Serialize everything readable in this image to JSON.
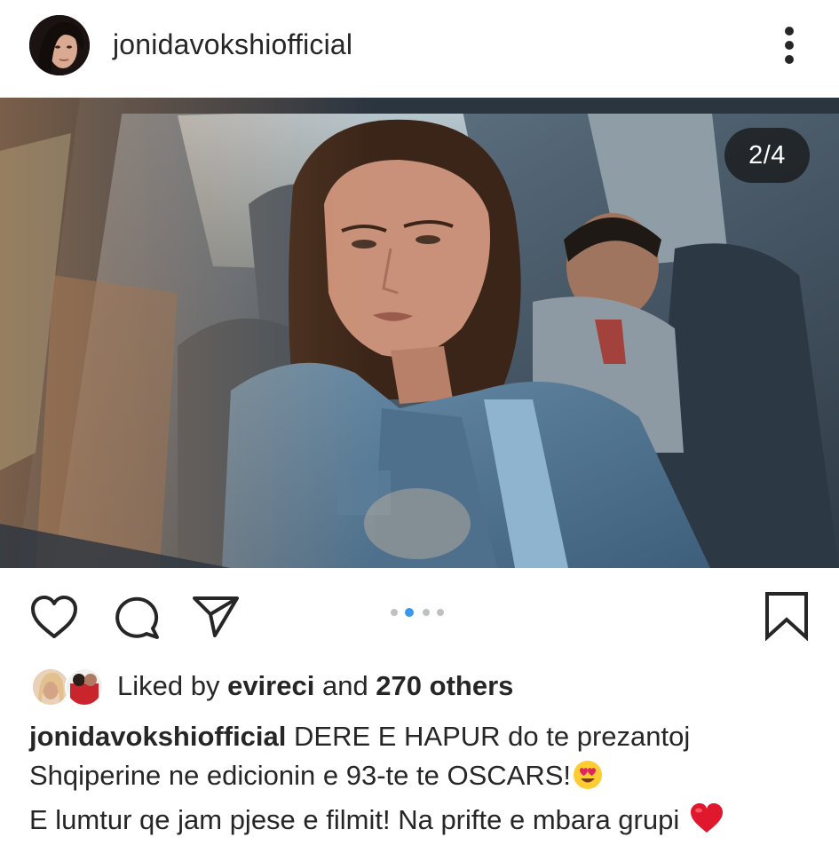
{
  "post": {
    "username": "jonidavokshiofficial",
    "more_icon": "more-vertical-icon",
    "counter": "2/4",
    "carousel_total": 4,
    "carousel_active_index": 2,
    "colors": {
      "accent": "#3897f0",
      "text": "#262626",
      "heart": "#e0245e"
    }
  },
  "actions": {
    "like_icon": "heart-icon",
    "comment_icon": "comment-icon",
    "share_icon": "paper-plane-icon",
    "save_icon": "bookmark-icon"
  },
  "likes": {
    "prefix": "Liked by ",
    "first_liker": "evireci",
    "connector": " and ",
    "others": "270 others"
  },
  "caption": {
    "username": "jonidavokshiofficial",
    "line1": " DERE E HAPUR do te prezantoj",
    "line2": "Shqiperine ne edicionin e 93-te te OSCARS!",
    "line3": "E lumtur qe jam pjese e filmit! Na prifte e mbara grupi ",
    "emoji_heart_eyes": "smiling-face-with-heart-eyes-emoji",
    "emoji_heart": "red-heart-emoji"
  }
}
